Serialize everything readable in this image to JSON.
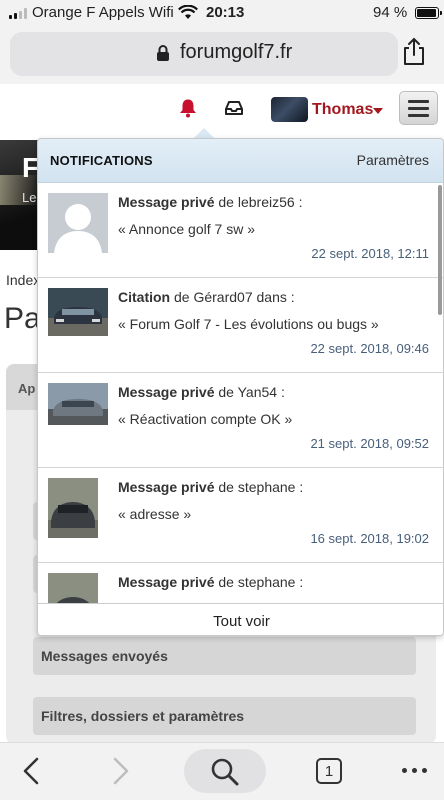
{
  "status_bar": {
    "carrier": "Orange F Appels Wifi",
    "time": "20:13",
    "battery": "94 %",
    "battery_level": 0.94
  },
  "browser": {
    "url": "forumgolf7.fr"
  },
  "header": {
    "username": "Thomas",
    "accent_color": "#a1191f"
  },
  "page": {
    "banner_letter": "F",
    "banner_sub": "Le",
    "breadcrumb": "Index",
    "title": "Pa",
    "tab_stub": "Ap",
    "side_buttons": [
      "Messages envoyés",
      "Filtres, dossiers et paramètres"
    ]
  },
  "notifications": {
    "title": "NOTIFICATIONS",
    "settings_label": "Paramètres",
    "see_all": "Tout voir",
    "items": [
      {
        "type": "Message privé",
        "connector": "de",
        "user": "lebreiz56 :",
        "content": "« Annonce golf 7 sw »",
        "time": "22 sept. 2018, 12:11",
        "thumb": "default-avatar"
      },
      {
        "type": "Citation",
        "connector": "de",
        "user": "Gérard07 dans :",
        "content": "« Forum Golf 7 - Les évolutions ou bugs »",
        "time": "22 sept. 2018, 09:46",
        "thumb": "car-photo-dark"
      },
      {
        "type": "Message privé",
        "connector": "de",
        "user": "Yan54 :",
        "content": "« Réactivation compte OK »",
        "time": "21 sept. 2018, 09:52",
        "thumb": "car-photo-grey"
      },
      {
        "type": "Message privé",
        "connector": "de",
        "user": "stephane :",
        "content": "« adresse »",
        "time": "16 sept. 2018, 19:02",
        "thumb": "car-photo-parked"
      },
      {
        "type": "Message privé",
        "connector": "de",
        "user": "stephane :",
        "content": "",
        "time": "",
        "thumb": "car-photo-parked"
      }
    ]
  },
  "toolbar": {
    "tab_count": "1"
  }
}
